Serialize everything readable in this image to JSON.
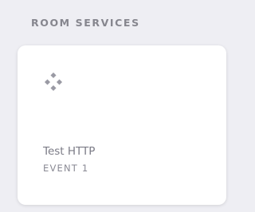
{
  "section": {
    "title": "ROOM SERVICES"
  },
  "services": [
    {
      "name": "Test HTTP",
      "event": "EVENT 1",
      "icon": "diamond-grid-icon"
    }
  ],
  "colors": {
    "background": "#eeeef3",
    "card": "#ffffff",
    "heading": "#86868e",
    "icon": "#9a9aa4"
  }
}
